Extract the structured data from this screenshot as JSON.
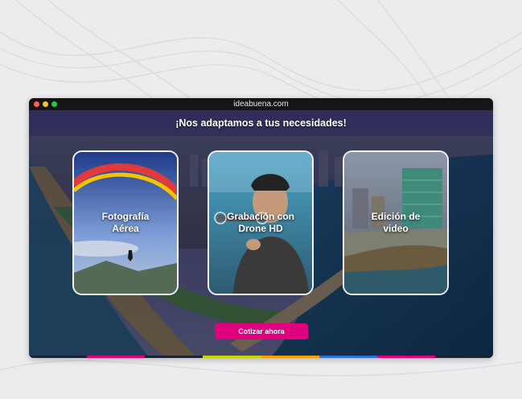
{
  "window": {
    "url": "ideabuena.com"
  },
  "hero": {
    "headline": "¡Nos adaptamos a tus necesidades!",
    "cards": [
      {
        "label": "Fotografía\nAérea",
        "image": "paraglider-photo"
      },
      {
        "label": "Grabación con\nDrone HD",
        "image": "drone-operator-photo"
      },
      {
        "label": "Edición de\nvideo",
        "image": "coastal-buildings-photo"
      }
    ],
    "cta_label": "Cotizar ahora"
  },
  "colors": {
    "accent": "#e0007e",
    "stripes": [
      "#1a2236",
      "#e0007e",
      "#1a2236",
      "#c8d400",
      "#f5a000",
      "#2f6fd6",
      "#e0007e",
      "#1a2236"
    ]
  }
}
